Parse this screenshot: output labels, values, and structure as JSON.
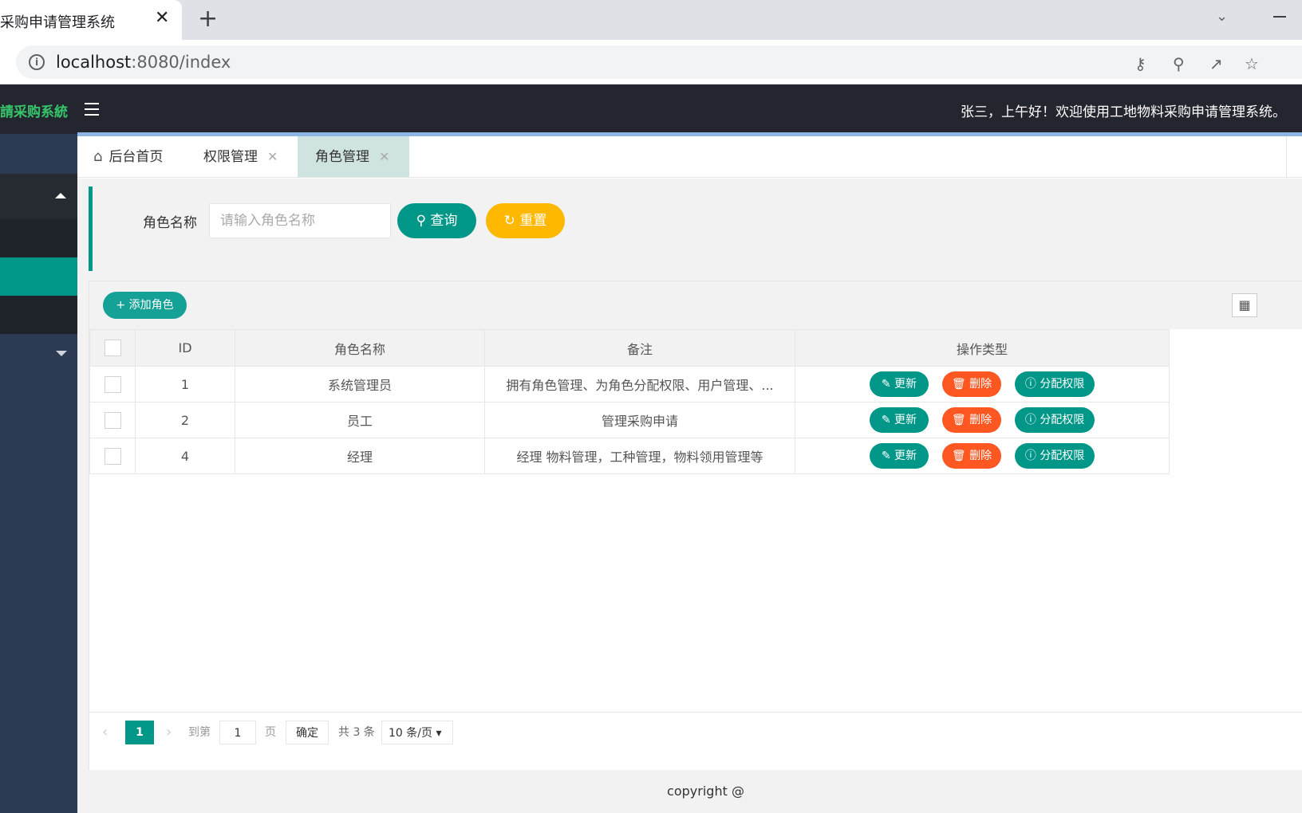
{
  "browser": {
    "tab_title": "采购申请管理系统",
    "close_glyph": "✕",
    "newtab_glyph": "+",
    "url_host": "localhost",
    "url_path": ":8080/index"
  },
  "app": {
    "logo": "請采购系統",
    "welcome": "张三，上午好！欢迎使用工地物料采购申请管理系统。"
  },
  "page_tabs": [
    {
      "label": "后台首页"
    },
    {
      "label": "权限管理"
    },
    {
      "label": "角色管理"
    }
  ],
  "search": {
    "label": "角色名称",
    "placeholder": "请输入角色名称",
    "query_btn": "查询",
    "reset_btn": "重置"
  },
  "toolbar": {
    "add_btn": "添加角色"
  },
  "table": {
    "headers": [
      "ID",
      "角色名称",
      "备注",
      "操作类型"
    ],
    "rows": [
      {
        "id": "1",
        "name": "系统管理员",
        "note": "拥有角色管理、为角色分配权限、用户管理、..."
      },
      {
        "id": "2",
        "name": "员工",
        "note": "管理采购申请"
      },
      {
        "id": "4",
        "name": "经理",
        "note": "经理 物料管理，工种管理，物料领用管理等"
      }
    ],
    "actions": {
      "edit": "更新",
      "delete": "删除",
      "assign": "分配权限"
    }
  },
  "pager": {
    "current": "1",
    "goto_label": "到第",
    "goto_value": "1",
    "page_unit": "页",
    "confirm": "确定",
    "total": "共 3 条",
    "page_size": "10 条/页"
  },
  "footer": {
    "text": "copyright @"
  }
}
